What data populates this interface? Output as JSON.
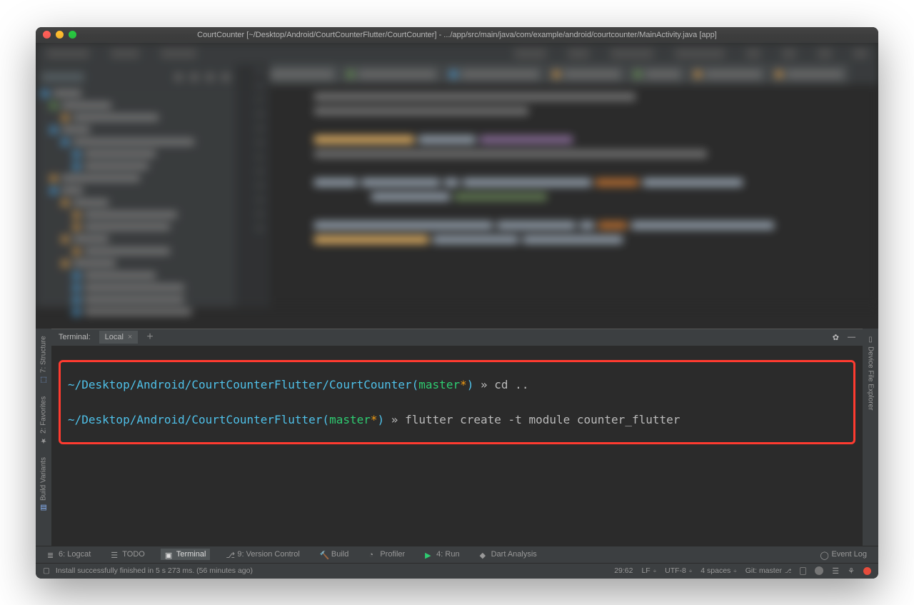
{
  "window": {
    "title": "CourtCounter [~/Desktop/Android/CourtCounterFlutter/CourtCounter] - .../app/src/main/java/com/example/android/courtcounter/MainActivity.java [app]"
  },
  "terminal": {
    "header_label": "Terminal:",
    "tab_label": "Local",
    "lines": [
      {
        "path": "~/Desktop/Android/CourtCounterFlutter/CourtCounter",
        "branch": "master",
        "dirty": "*",
        "arrow": "»",
        "command": "cd .."
      },
      {
        "path": "~/Desktop/Android/CourtCounterFlutter",
        "branch": "master",
        "dirty": "*",
        "arrow": "»",
        "command": "flutter create -t module counter_flutter"
      }
    ]
  },
  "bottom_tabs": {
    "logcat": "6: Logcat",
    "todo": "TODO",
    "terminal": "Terminal",
    "vcs": "9: Version Control",
    "build": "Build",
    "profiler": "Profiler",
    "run": "4: Run",
    "dart": "Dart Analysis",
    "event_log": "Event Log"
  },
  "side_tabs": {
    "structure": "7: Structure",
    "favorites": "2: Favorites",
    "build_variants": "Build Variants",
    "device_explorer": "Device File Explorer"
  },
  "status": {
    "message": "Install successfully finished in 5 s 273 ms. (56 minutes ago)",
    "position": "29:62",
    "line_ending": "LF",
    "encoding": "UTF-8",
    "indent": "4 spaces",
    "git": "Git: master"
  },
  "blurred_code": {
    "gutter": [
      "25",
      "26",
      "27",
      "28",
      "29",
      "30",
      "31",
      "32",
      "33",
      "34",
      "35",
      "36"
    ]
  }
}
